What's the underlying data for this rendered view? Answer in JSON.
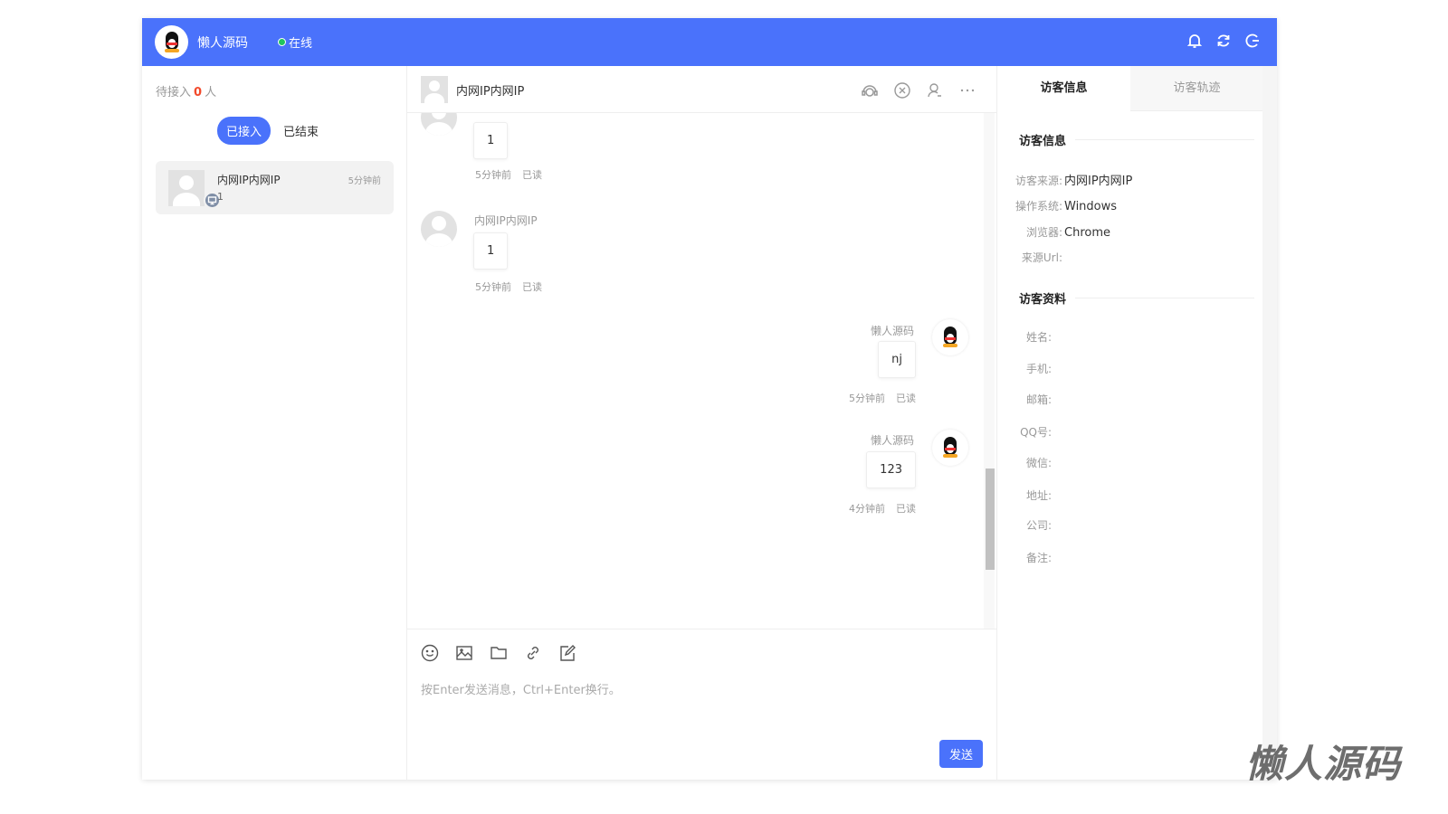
{
  "header": {
    "agent_name": "懒人源码",
    "status": "在线"
  },
  "left": {
    "waiting_prefix": "待接入",
    "waiting_count": "0",
    "waiting_suffix": "人",
    "tabs": [
      "已接入",
      "已结束"
    ],
    "conversations": [
      {
        "name": "内网IP内网IP",
        "time": "5分钟前",
        "last_message": "1"
      }
    ]
  },
  "chat": {
    "title": "内网IP内网IP",
    "messages": [
      {
        "from": "visitor",
        "sender": "",
        "text": "1",
        "time": "5分钟前",
        "status": "已读"
      },
      {
        "from": "visitor",
        "sender": "内网IP内网IP",
        "text": "1",
        "time": "5分钟前",
        "status": "已读"
      },
      {
        "from": "agent",
        "sender": "懒人源码",
        "text": "nj",
        "time": "5分钟前",
        "status": "已读"
      },
      {
        "from": "agent",
        "sender": "懒人源码",
        "text": "123",
        "time": "4分钟前",
        "status": "已读"
      }
    ],
    "placeholder": "按Enter发送消息，Ctrl+Enter换行。",
    "send_label": "发送"
  },
  "right": {
    "tabs": [
      "访客信息",
      "访客轨迹"
    ],
    "info_title": "访客信息",
    "info": [
      {
        "label": "访客来源:",
        "value": "内网IP内网IP"
      },
      {
        "label": "操作系统:",
        "value": "Windows"
      },
      {
        "label": "浏览器:",
        "value": "Chrome"
      },
      {
        "label": "来源Url:",
        "value": ""
      }
    ],
    "profile_title": "访客资料",
    "profile": [
      {
        "label": "姓名:"
      },
      {
        "label": "手机:"
      },
      {
        "label": "邮箱:"
      },
      {
        "label": "QQ号:"
      },
      {
        "label": "微信:"
      },
      {
        "label": "地址:"
      },
      {
        "label": "公司:"
      },
      {
        "label": "备注:"
      }
    ]
  },
  "watermark": "懒人源码",
  "colors": {
    "primary": "#4a72fb",
    "online": "#22c55e",
    "count": "#f24a2b"
  }
}
